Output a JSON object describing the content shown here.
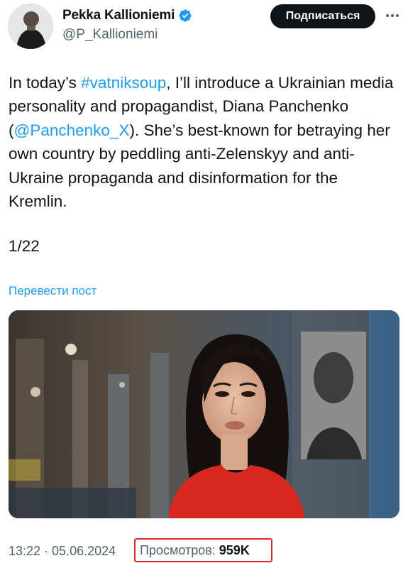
{
  "author": {
    "display_name": "Pekka Kallioniemi",
    "handle": "@P_Kallioniemi",
    "verified": true
  },
  "actions": {
    "subscribe_label": "Подписаться"
  },
  "tweet": {
    "intro": "In today’s ",
    "hashtag": "#vatniksoup",
    "text_1": ", I’ll introduce a Ukrainian media personality and propagandist, Diana Panchenko (",
    "mention": "@Panchenko_X",
    "text_2": "). She’s best-known for betraying her own country by peddling anti-Zelenskyy and anti-Ukraine propaganda and disinformation for the Kremlin.",
    "thread_count": "1/22",
    "translate_label": "Перевести пост"
  },
  "meta": {
    "time": "13:22",
    "separator": " · ",
    "date": "05.06.2024",
    "views_label": "Просмотров:",
    "views_count": "959K"
  },
  "colors": {
    "accent": "#1d9bf0",
    "text": "#0f1419",
    "secondary": "#536471",
    "highlight_box": "#e0262b",
    "verified_badge": "#1d9bf0"
  },
  "icons": {
    "verified": "verified-badge-icon",
    "more": "more-options-icon"
  }
}
